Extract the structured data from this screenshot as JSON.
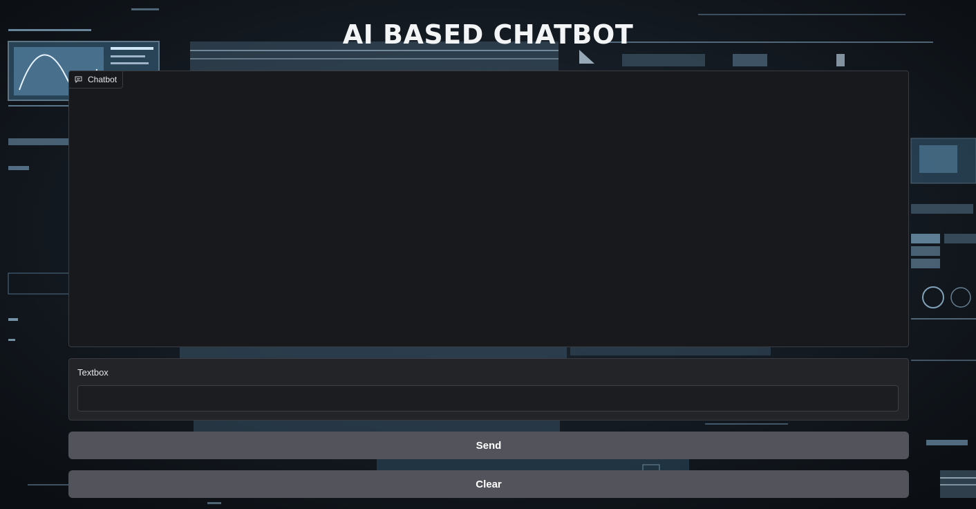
{
  "page": {
    "title": "AI BASED CHATBOT"
  },
  "chatbot": {
    "label": "Chatbot",
    "icon": "chat-bubble-icon",
    "messages": []
  },
  "textbox": {
    "label": "Textbox",
    "value": "",
    "placeholder": ""
  },
  "buttons": {
    "send_label": "Send",
    "clear_label": "Clear"
  },
  "colors": {
    "background": "#0d1116",
    "panel": "#18191c",
    "button": "#52535b",
    "text": "#f3f4f6"
  }
}
